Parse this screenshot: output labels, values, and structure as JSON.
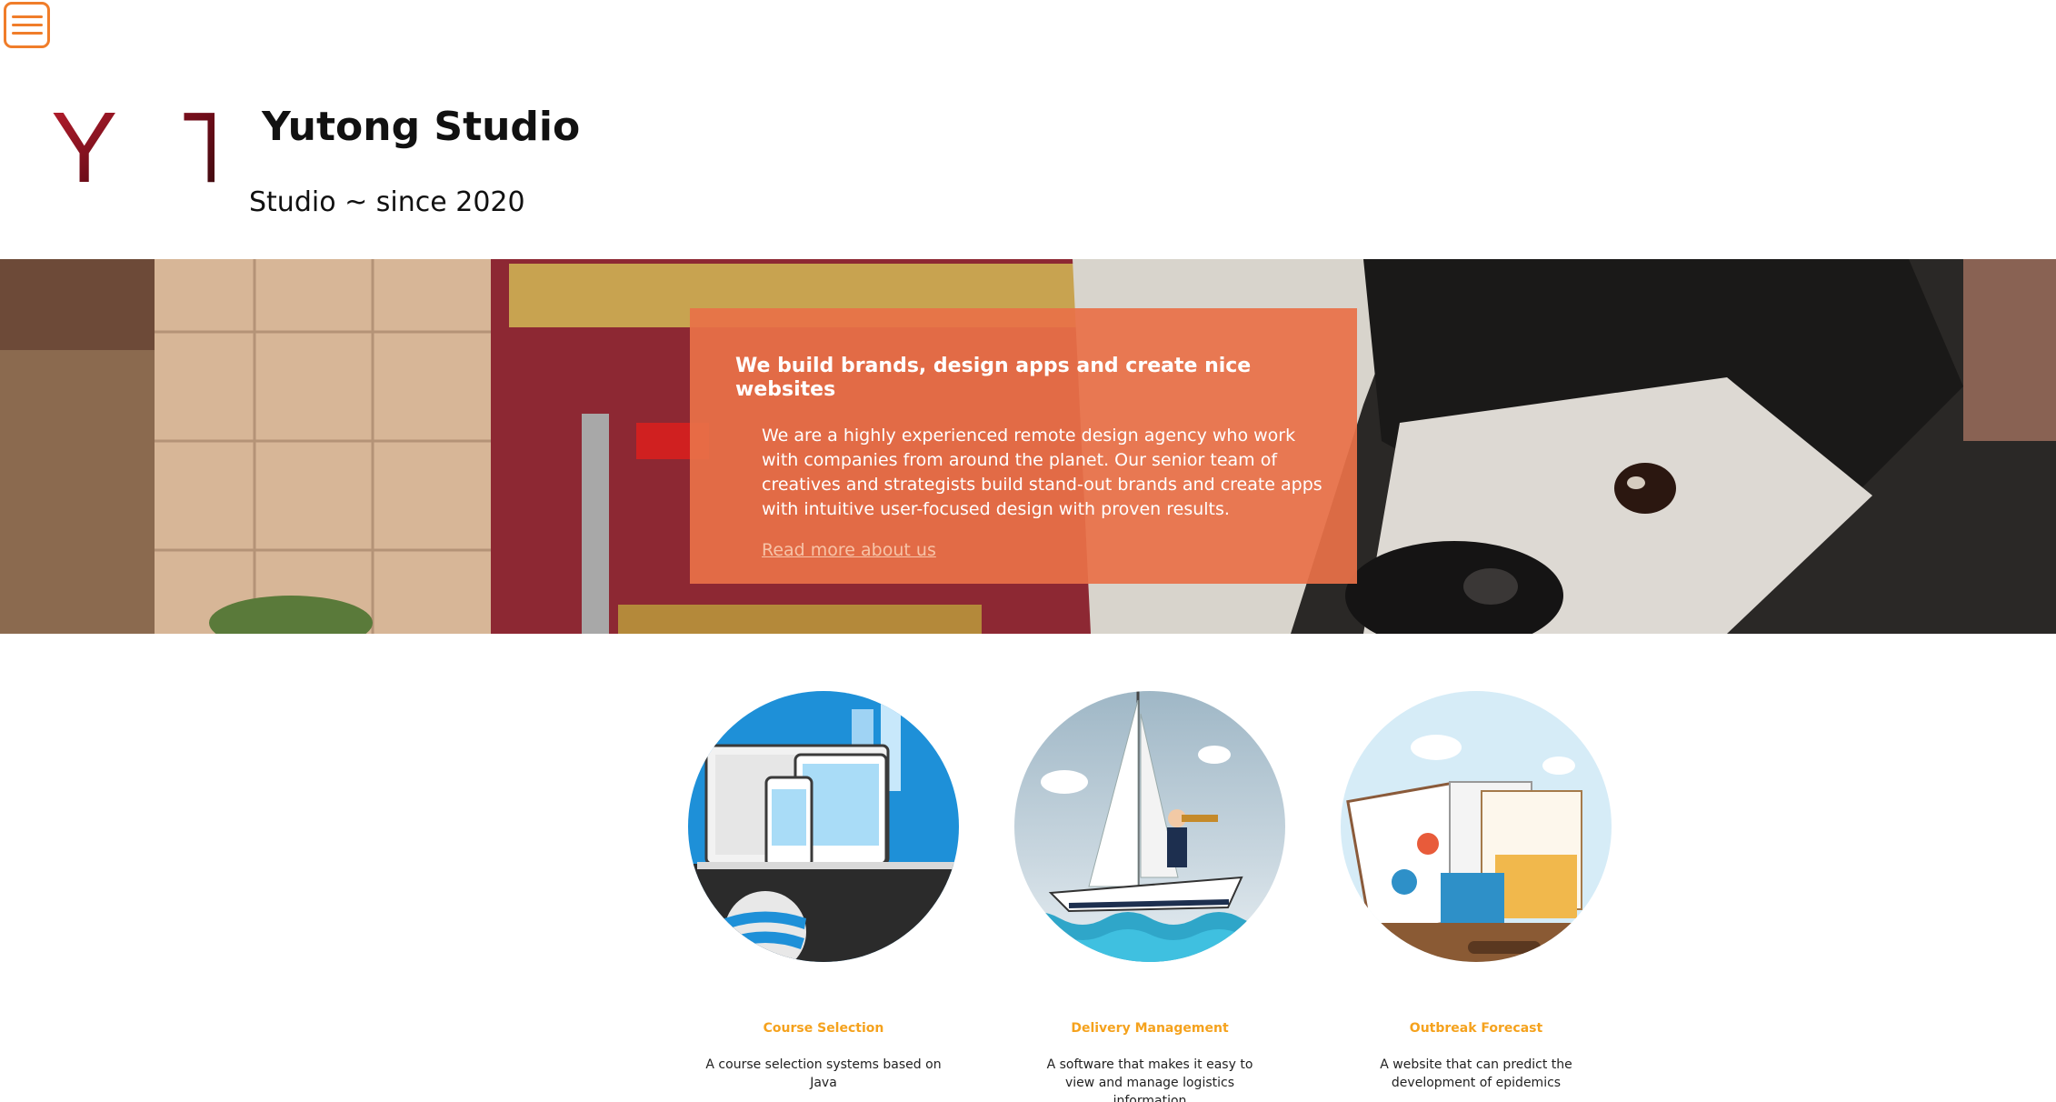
{
  "header": {
    "menu_icon": "hamburger-menu-icon",
    "logo_text": "Y T",
    "title": "Yutong Studio",
    "subtitle": "Studio ~ since 2020"
  },
  "hero": {
    "heading": "We build brands, design apps and create nice websites",
    "body": "We are a highly experienced remote design agency who work with companies from around the planet. Our senior team of creatives and strategists build stand-out brands and create apps with intuitive user-focused design with proven results.",
    "link": "Read more about us"
  },
  "features": [
    {
      "title": "Course Selection",
      "description": "A course selection systems based on Java",
      "icon": "devices-icon"
    },
    {
      "title": "Delivery Management",
      "description": "A software that makes it easy to view and manage logistics information",
      "icon": "sailboat-icon"
    },
    {
      "title": "Outbreak Forecast",
      "description": "A website that can predict the development of epidemics",
      "icon": "briefcase-icon"
    }
  ],
  "colors": {
    "accent": "#f07d2a",
    "card": "#e87148",
    "feature_title": "#f5a21d"
  }
}
